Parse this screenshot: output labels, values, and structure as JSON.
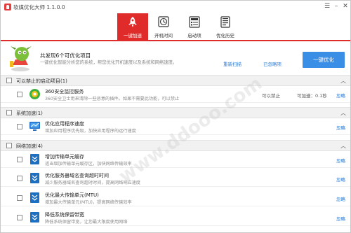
{
  "window": {
    "title": "软媒优化大师 1.1.0.0"
  },
  "tabs": [
    {
      "label": "一键加速"
    },
    {
      "label": "开机时间"
    },
    {
      "label": "启动项"
    },
    {
      "label": "优化历史"
    }
  ],
  "summary": {
    "title": "共发现6个可优化项目",
    "desc": "一键优化智能分析您的系统，帮您优化开机速度以及系统和网络速度。",
    "rescan": "重新扫描",
    "ignored": "已忽略项",
    "optimize_btn": "一键优化"
  },
  "sections": [
    {
      "title": "可以禁止的启动项目(1)",
      "items": [
        {
          "name": "360安全监控服务",
          "desc": "360安全卫士用来清除一些恶意的插件。如果不需要此功能，可以禁止",
          "status": "可以禁止",
          "time": "可加速：0.1秒",
          "ignore": "忽略"
        }
      ]
    },
    {
      "title": "系统加速(1)",
      "items": [
        {
          "name": "优化应用程序速度",
          "desc": "增加应用程序优先级，加快应用程序的运行速度",
          "status": "",
          "time": "",
          "ignore": "忽略"
        }
      ]
    },
    {
      "title": "网络加速(4)",
      "items": [
        {
          "name": "增加传输单元缓存",
          "desc": "适当增加传输单元缓存区，加快网络传输效率",
          "status": "",
          "time": "",
          "ignore": "忽略"
        },
        {
          "name": "优化服务器域名查询超时时间",
          "desc": "减少服务器域名查询超时时间，提高网络响应速度",
          "status": "",
          "time": "",
          "ignore": "忽略"
        },
        {
          "name": "优化最大传输单元(MTU)",
          "desc": "增加最大传输单元(MTU)，提高网络传输效率",
          "status": "",
          "time": "",
          "ignore": "忽略"
        },
        {
          "name": "降低系统保留带宽",
          "desc": "降低系统保留带宽，让您最大限度使用网络",
          "status": "",
          "time": "",
          "ignore": "忽略"
        }
      ]
    }
  ],
  "watermark": "www.ddooo.com",
  "colors": {
    "accent": "#e02b2b",
    "link": "#2b7bd6",
    "button": "#3b8ee6"
  },
  "icons": {
    "tab1": "rocket-icon",
    "tab2": "clock-icon",
    "tab3": "startup-list-icon",
    "tab4": "history-book-icon",
    "item": [
      "shield-360-icon",
      "monitor-icon",
      "network-doc-icon",
      "network-doc-icon",
      "network-doc-icon",
      "network-doc-icon"
    ]
  }
}
